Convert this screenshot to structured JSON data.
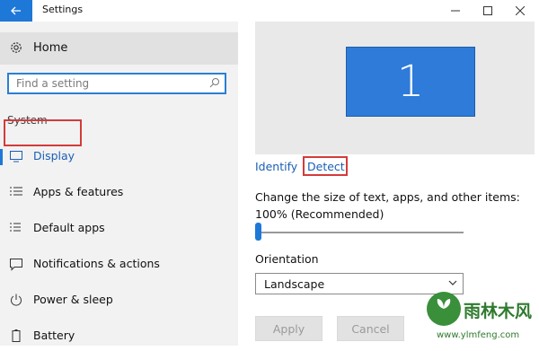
{
  "window": {
    "title": "Settings",
    "icons": [
      "back-arrow-icon",
      "minimize-icon",
      "maximize-icon",
      "close-icon"
    ]
  },
  "sidebar": {
    "home_label": "Home",
    "search_placeholder": "Find a setting",
    "section_label": "System",
    "items": [
      {
        "label": "Display",
        "icon": "monitor-icon",
        "selected": true
      },
      {
        "label": "Apps & features",
        "icon": "list-icon"
      },
      {
        "label": "Default apps",
        "icon": "default-apps-icon"
      },
      {
        "label": "Notifications & actions",
        "icon": "message-icon"
      },
      {
        "label": "Power & sleep",
        "icon": "power-icon"
      },
      {
        "label": "Battery",
        "icon": "battery-icon"
      }
    ]
  },
  "main": {
    "monitor_number": "1",
    "identify_label": "Identify",
    "detect_label": "Detect",
    "scale_label": "Change the size of text, apps, and other items: 100% (Recommended)",
    "scale_value": 0,
    "orientation_label": "Orientation",
    "orientation_value": "Landscape",
    "apply_label": "Apply",
    "cancel_label": "Cancel"
  },
  "watermark": {
    "text": "雨林木风",
    "url": "www.ylmfeng.com"
  },
  "colors": {
    "accent": "#1e78d7",
    "annotation_red": "#d43b3b",
    "sidebar_bg": "#f2f2f2",
    "link": "#1a5fb4"
  }
}
